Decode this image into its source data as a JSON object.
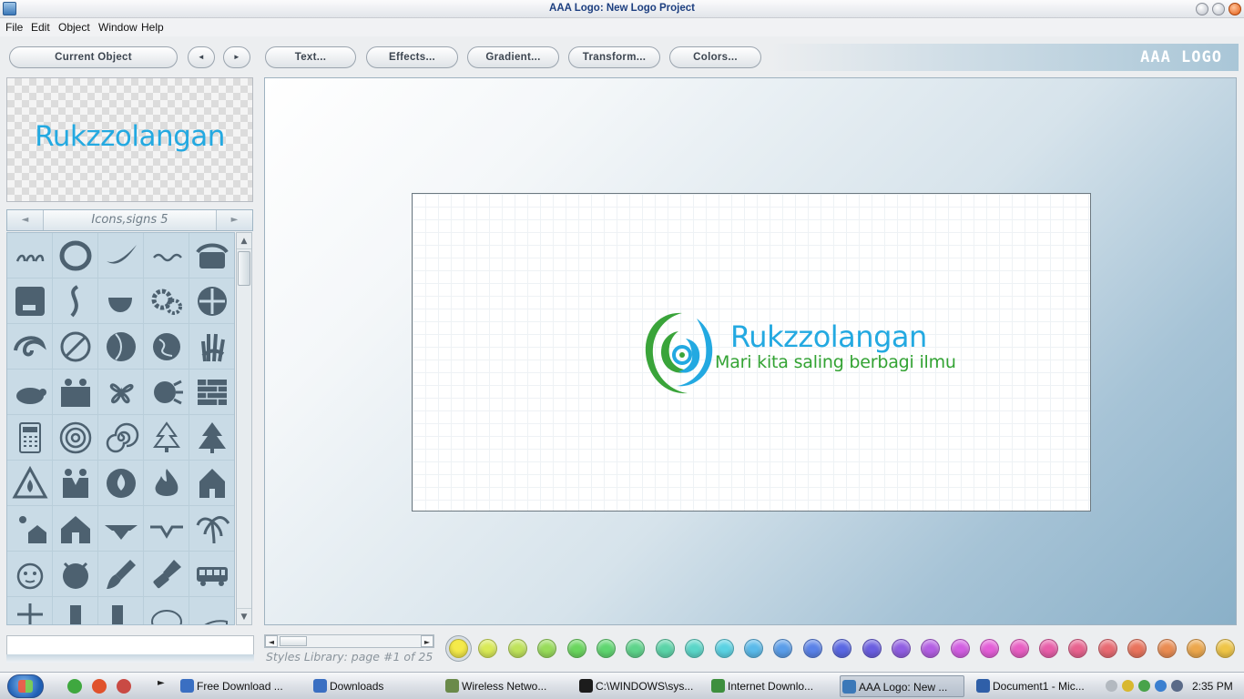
{
  "window": {
    "title": "AAA Logo: New Logo Project"
  },
  "menu": [
    "File",
    "Edit",
    "Object",
    "Window",
    "Help"
  ],
  "toolbar": {
    "current_object": "Current Object",
    "prev": "◄",
    "next": "►",
    "text": "Text...",
    "effects": "Effects...",
    "gradient": "Gradient...",
    "transform": "Transform...",
    "colors": "Colors...",
    "brand": "AAA LOGO"
  },
  "preview": {
    "text": "Rukzzolangan"
  },
  "library": {
    "title": "Icons,signs 5",
    "prev": "◄",
    "next": "►",
    "icons": [
      "swirls-icon",
      "ring-icon",
      "swoosh-icon",
      "wave-icon",
      "telephone-icon",
      "hot-coffee-icon",
      "s-curve-icon",
      "cup-icon",
      "gears-icon",
      "pinwheel-icon",
      "wave-curl-icon",
      "no-smoking-icon",
      "ball-icon",
      "globe-icon",
      "hand-print-icon",
      "turtle-icon",
      "family-icon",
      "flower-icon",
      "splash-icon",
      "brick-wall-icon",
      "calculator-icon",
      "spiral-icon",
      "spiral-2-icon",
      "christmas-tree-outline-icon",
      "christmas-tree-icon",
      "fire-warning-icon",
      "handshake-icon",
      "fire-circle-icon",
      "flame-icon",
      "house-building-icon",
      "sun-house-icon",
      "house-icon",
      "wings-icon",
      "wing-line-icon",
      "palm-tree-icon",
      "face-icon",
      "bomb-icon",
      "paintbrush-icon",
      "stamp-icon",
      "bus-icon",
      "cross-icon",
      "boot-icon",
      "boot-2-icon",
      "speech-bubble-icon",
      "hat-icon"
    ]
  },
  "canvas": {
    "title": "Rukzzolangan",
    "tagline": "Mari kita saling berbagi ilmu"
  },
  "styles": {
    "caption": "Styles Library: page #1 of 25",
    "field_value": "",
    "swatches": [
      "#f4ea4a",
      "#d9ea56",
      "#bfe35a",
      "#98dc5a",
      "#6ad65e",
      "#5fd670",
      "#5ed48b",
      "#5bd4a8",
      "#5ad6c8",
      "#5ad2e3",
      "#5abaea",
      "#5a9de9",
      "#5a82e8",
      "#5a68e3",
      "#6a5ee0",
      "#905ee2",
      "#b35ee3",
      "#d25ee2",
      "#e45ed8",
      "#e85ec3",
      "#e85ea9",
      "#e8628e",
      "#e86a72",
      "#e9735c",
      "#ea8c52",
      "#eca74c",
      "#efc547"
    ],
    "selected_swatch": 0
  },
  "taskbar": {
    "tasks": [
      "Free Download ...",
      "Downloads",
      "Wireless Netwo...",
      "C:\\WINDOWS\\sys...",
      "Internet Downlo...",
      "AAA Logo: New ...",
      "Document1 - Mic..."
    ],
    "active_task": 5,
    "clock": "2:35 PM"
  }
}
